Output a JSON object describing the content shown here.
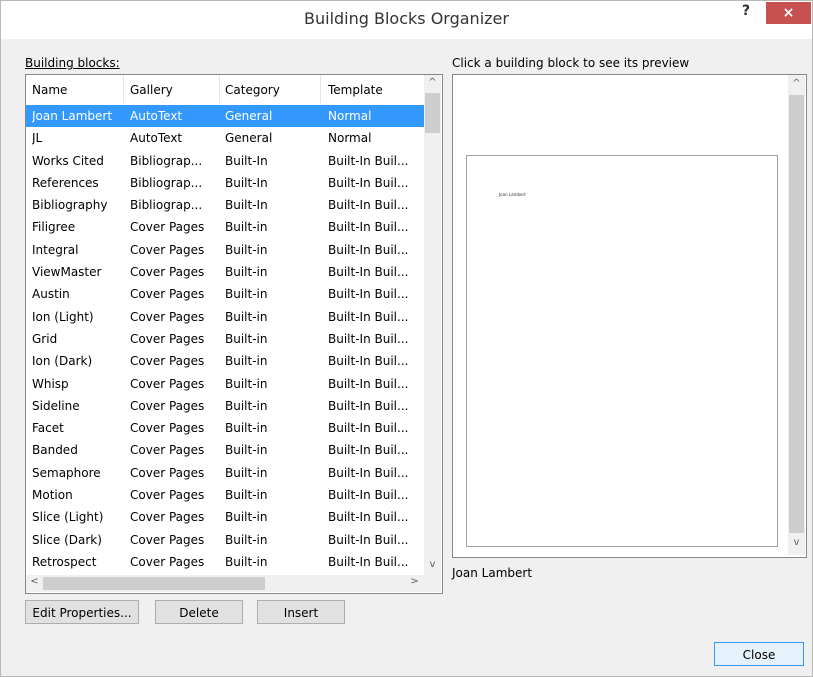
{
  "window": {
    "title": "Building Blocks Organizer",
    "help": "?",
    "close": "×"
  },
  "left_label": "Building blocks:",
  "right_label": "Click a building block to see its preview",
  "columns": [
    "Name",
    "Gallery",
    "Category",
    "Template"
  ],
  "rows": [
    [
      "Joan Lambert",
      "AutoText",
      "General",
      "Normal"
    ],
    [
      "JL",
      "AutoText",
      "General",
      "Normal"
    ],
    [
      "Works Cited",
      "Bibliograp...",
      "Built-In",
      "Built-In Buil..."
    ],
    [
      "References",
      "Bibliograp...",
      "Built-In",
      "Built-In Buil..."
    ],
    [
      "Bibliography",
      "Bibliograp...",
      "Built-In",
      "Built-In Buil..."
    ],
    [
      "Filigree",
      "Cover Pages",
      "Built-in",
      "Built-In Buil..."
    ],
    [
      "Integral",
      "Cover Pages",
      "Built-in",
      "Built-In Buil..."
    ],
    [
      "ViewMaster",
      "Cover Pages",
      "Built-in",
      "Built-In Buil..."
    ],
    [
      "Austin",
      "Cover Pages",
      "Built-in",
      "Built-In Buil..."
    ],
    [
      "Ion (Light)",
      "Cover Pages",
      "Built-in",
      "Built-In Buil..."
    ],
    [
      "Grid",
      "Cover Pages",
      "Built-in",
      "Built-In Buil..."
    ],
    [
      "Ion (Dark)",
      "Cover Pages",
      "Built-in",
      "Built-In Buil..."
    ],
    [
      "Whisp",
      "Cover Pages",
      "Built-in",
      "Built-In Buil..."
    ],
    [
      "Sideline",
      "Cover Pages",
      "Built-in",
      "Built-In Buil..."
    ],
    [
      "Facet",
      "Cover Pages",
      "Built-in",
      "Built-In Buil..."
    ],
    [
      "Banded",
      "Cover Pages",
      "Built-in",
      "Built-In Buil..."
    ],
    [
      "Semaphore",
      "Cover Pages",
      "Built-in",
      "Built-In Buil..."
    ],
    [
      "Motion",
      "Cover Pages",
      "Built-in",
      "Built-In Buil..."
    ],
    [
      "Slice (Light)",
      "Cover Pages",
      "Built-in",
      "Built-In Buil..."
    ],
    [
      "Slice (Dark)",
      "Cover Pages",
      "Built-in",
      "Built-In Buil..."
    ],
    [
      "Retrospect",
      "Cover Pages",
      "Built-in",
      "Built-In Buil..."
    ]
  ],
  "selected_index": 0,
  "buttons": {
    "edit": "Edit Properties...",
    "delete": "Delete",
    "insert": "Insert",
    "close": "Close"
  },
  "preview": {
    "page_text": "Joan Lambert",
    "caption": "Joan Lambert"
  },
  "scroll_arrows": {
    "up": "^",
    "down": "v",
    "left": "<",
    "right": ">"
  },
  "colors": {
    "selection": "#3399ff",
    "close_button": "#c75050"
  }
}
